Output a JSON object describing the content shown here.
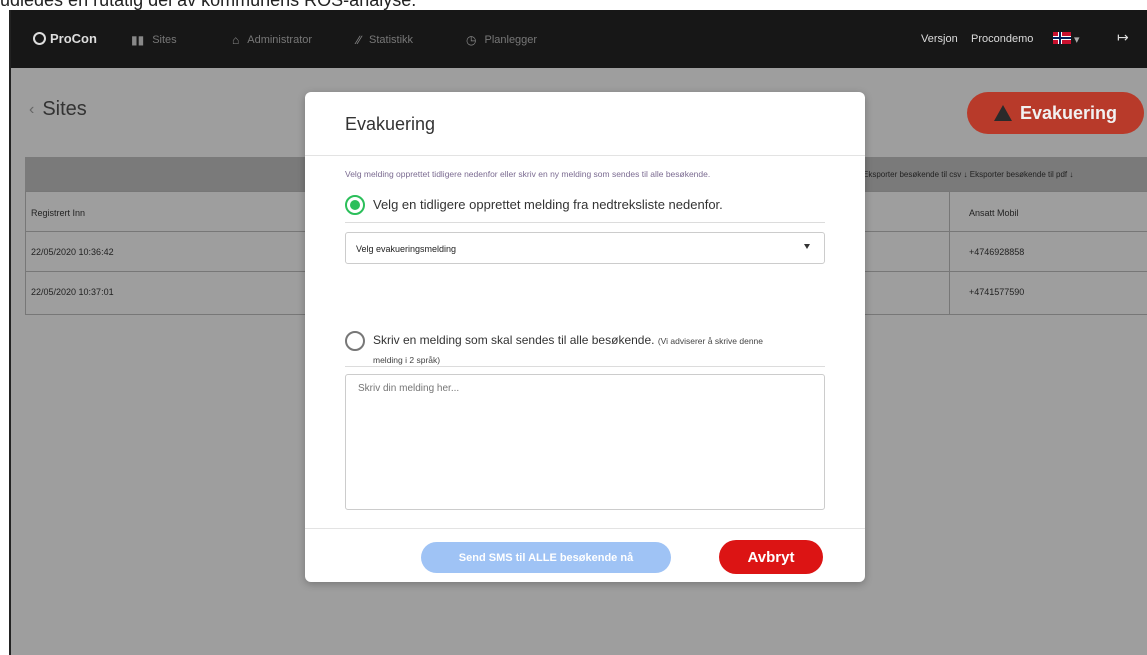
{
  "caption": "udledes en rutatig del av kommunens ROS-analyse.",
  "nav": {
    "logo": "ProCon",
    "items": [
      {
        "label": "Sites",
        "icon": "sites-icon"
      },
      {
        "label": "Administrator",
        "icon": "home-icon"
      },
      {
        "label": "Statistikk",
        "icon": "chart-icon"
      },
      {
        "label": "Planlegger",
        "icon": "clock-icon"
      }
    ],
    "version": "Versjon",
    "user": "Procondemo",
    "language": "Norwegian",
    "logout_icon": "logout-icon"
  },
  "page": {
    "title": "Sites",
    "evac_button": "Evakuering",
    "export_csv": "Eksporter besøkende til csv",
    "export_pdf": "Eksporter besøkende til pdf",
    "columns": {
      "left": "Registrert Inn",
      "right": "Ansatt Mobil"
    },
    "rows": [
      {
        "left": "22/05/2020 10:36:42",
        "right": "+4746928858"
      },
      {
        "left": "22/05/2020 10:37:01",
        "right": "+4741577590"
      }
    ]
  },
  "modal": {
    "title": "Evakuering",
    "intro": "Velg melding opprettet tidligere nedenfor eller skriv en ny melding som sendes til alle besøkende.",
    "option1": "Velg en tidligere opprettet melding fra nedtreksliste nedenfor.",
    "select_value": "Velg evakueringsmelding",
    "option2_main": "Skriv en melding som skal sendes til alle besøkende.",
    "option2_note_a": "(Vi adviserer å skrive denne",
    "option2_note_b": "melding i 2 språk)",
    "textarea_placeholder": "Skriv din melding her...",
    "send_button": "Send SMS til ALLE besøkende nå",
    "cancel_button": "Avbryt"
  },
  "colors": {
    "accent_green": "#2bbf5a",
    "cancel_red": "#dc1414",
    "send_blue": "#9fc3f5",
    "evac_red": "#b83a2a"
  }
}
